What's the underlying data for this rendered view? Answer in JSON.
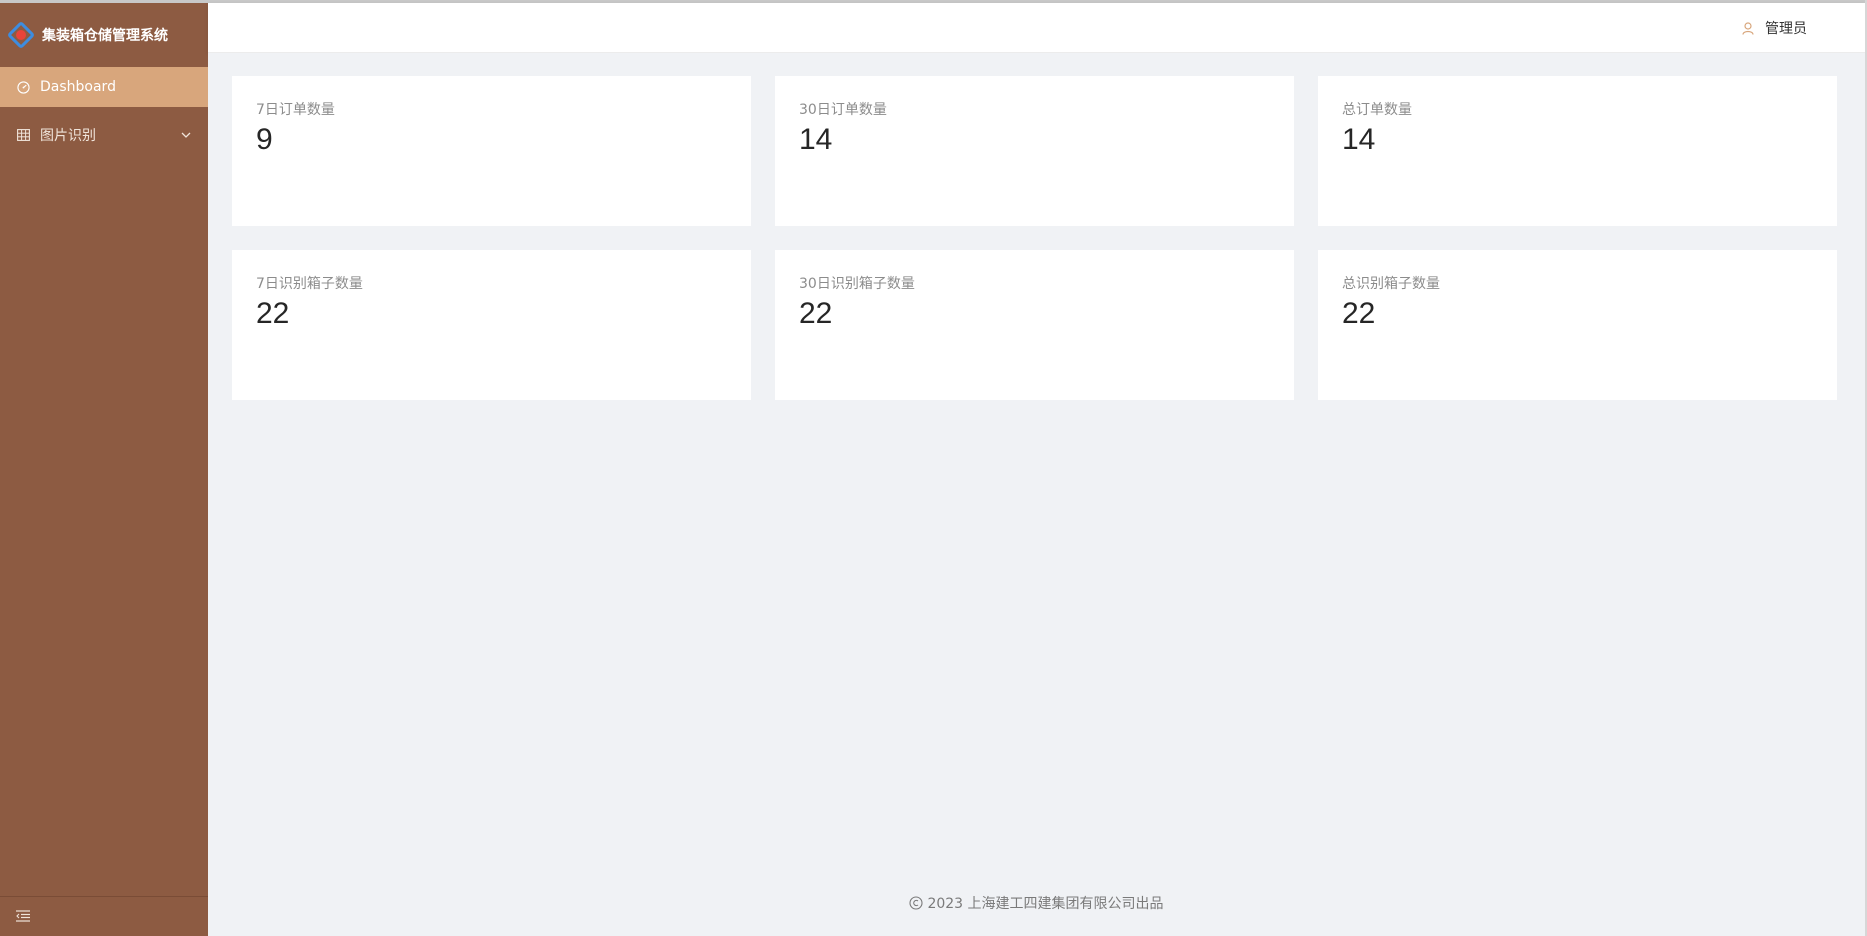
{
  "app": {
    "title": "集装箱仓储管理系统"
  },
  "sidebar": {
    "items": [
      {
        "label": "Dashboard",
        "icon": "dashboard-icon",
        "active": true
      },
      {
        "label": "图片识别",
        "icon": "table-icon",
        "active": false,
        "has_submenu": true
      }
    ],
    "collapse_icon": "menu-fold-icon"
  },
  "header": {
    "user_label": "管理员",
    "user_icon": "user-icon"
  },
  "stats": [
    {
      "title": "7日订单数量",
      "value": "9"
    },
    {
      "title": "30日订单数量",
      "value": "14"
    },
    {
      "title": "总订单数量",
      "value": "14"
    },
    {
      "title": "7日识别箱子数量",
      "value": "22"
    },
    {
      "title": "30日识别箱子数量",
      "value": "22"
    },
    {
      "title": "总识别箱子数量",
      "value": "22"
    }
  ],
  "footer": {
    "text": "2023 上海建工四建集团有限公司出品",
    "icon": "copyright-icon"
  },
  "colors": {
    "sidebar_bg": "#8d5b42",
    "sidebar_active": "#d8a67c",
    "content_bg": "#f0f2f5"
  }
}
